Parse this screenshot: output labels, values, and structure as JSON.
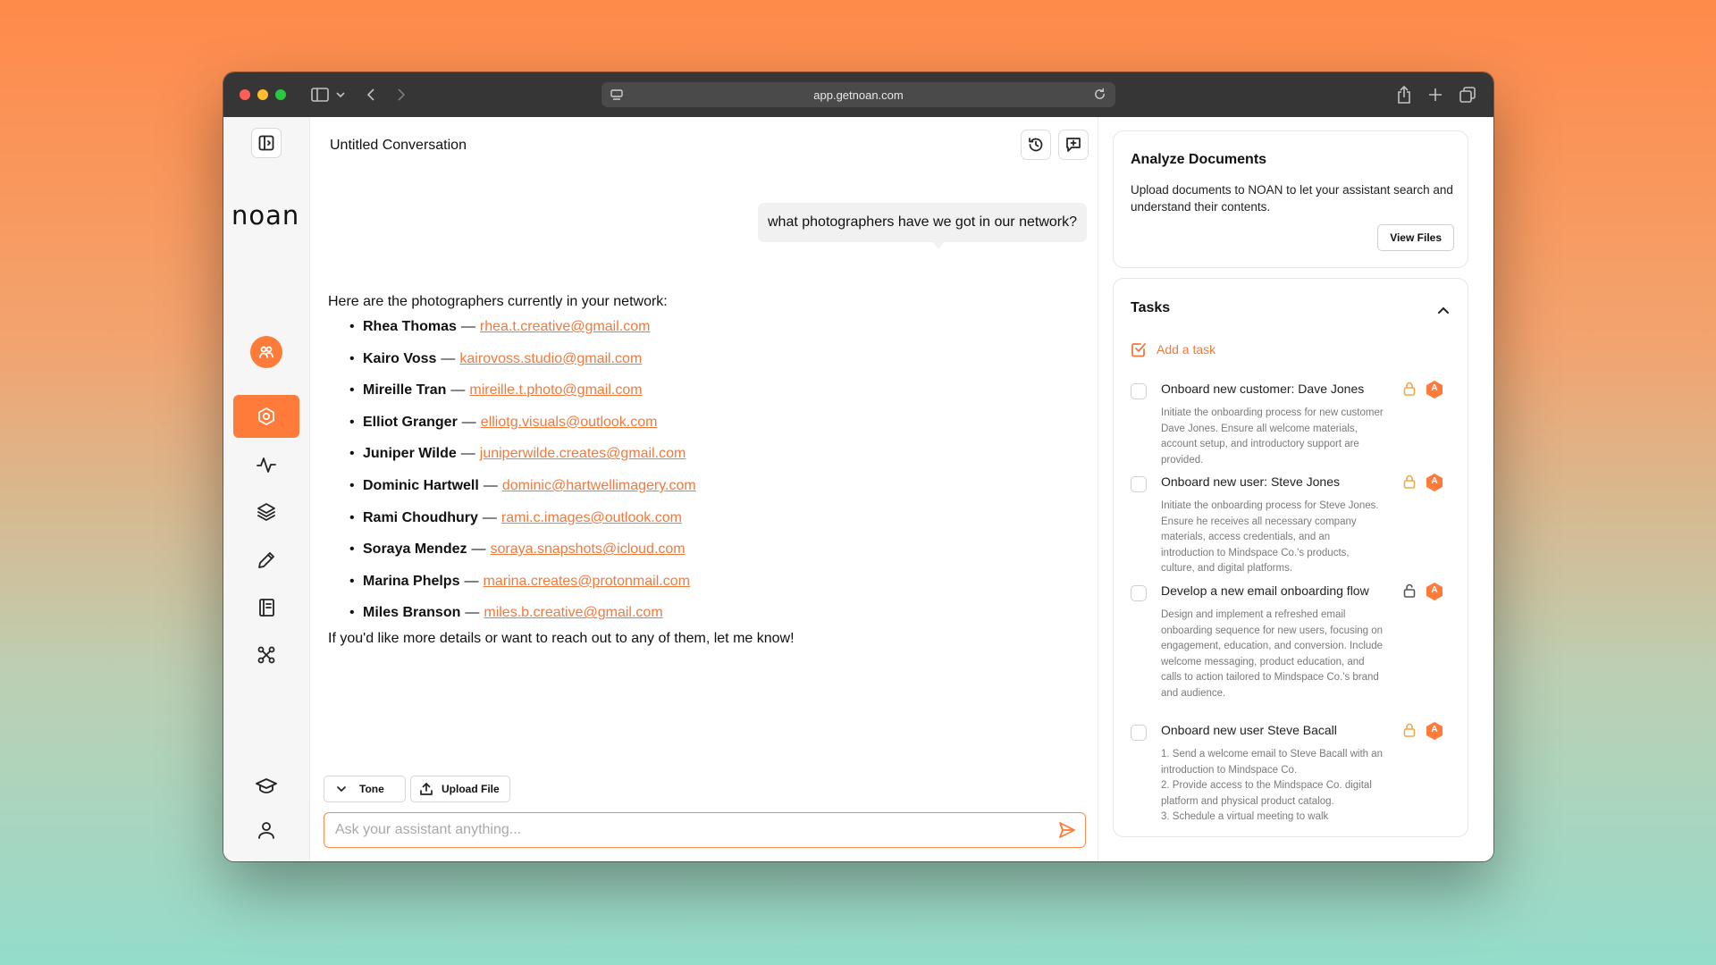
{
  "browser": {
    "url": "app.getnoan.com"
  },
  "rail": {
    "logo": "noan"
  },
  "chat": {
    "title": "Untitled Conversation",
    "user_message": "what photographers have we got in our network?",
    "assistant_intro": "Here are the photographers currently in your network:",
    "photographers": [
      {
        "name": "Rhea Thomas",
        "email": "rhea.t.creative@gmail.com"
      },
      {
        "name": "Kairo Voss",
        "email": "kairovoss.studio@gmail.com"
      },
      {
        "name": "Mireille Tran",
        "email": "mireille.t.photo@gmail.com"
      },
      {
        "name": "Elliot Granger",
        "email": "elliotg.visuals@outlook.com"
      },
      {
        "name": "Juniper Wilde",
        "email": "juniperwilde.creates@gmail.com"
      },
      {
        "name": "Dominic Hartwell",
        "email": "dominic@hartwellimagery.com"
      },
      {
        "name": "Rami Choudhury",
        "email": "rami.c.images@outlook.com"
      },
      {
        "name": "Soraya Mendez",
        "email": "soraya.snapshots@icloud.com"
      },
      {
        "name": "Marina Phelps",
        "email": "marina.creates@protonmail.com"
      },
      {
        "name": "Miles Branson",
        "email": "miles.b.creative@gmail.com"
      }
    ],
    "separator": "—",
    "assistant_outro": "If you'd like more details or want to reach out to any of them, let me know!",
    "tone_label": "Tone",
    "upload_label": "Upload File",
    "composer_placeholder": "Ask your assistant anything..."
  },
  "analyze": {
    "title": "Analyze Documents",
    "description": "Upload documents to NOAN to let your assistant search and understand their contents.",
    "button": "View Files"
  },
  "tasks": {
    "title": "Tasks",
    "add_label": "Add a task",
    "badge_letter": "A",
    "items": [
      {
        "title": "Onboard new customer: Dave Jones",
        "description": "Initiate the onboarding process for new customer Dave Jones. Ensure all welcome materials, account setup, and introductory support are provided.",
        "locked": true
      },
      {
        "title": "Onboard new user: Steve Jones",
        "description": "Initiate the onboarding process for Steve Jones. Ensure he receives all necessary company materials, access credentials, and an introduction to Mindspace Co.'s products, culture, and digital platforms.",
        "locked": true
      },
      {
        "title": "Develop a new email onboarding flow",
        "description": "Design and implement a refreshed email onboarding sequence for new users, focusing on engagement, education, and conversion. Include welcome messaging, product education, and calls to action tailored to Mindspace Co.'s brand and audience.",
        "locked": false
      },
      {
        "title": "Onboard new user Steve Bacall",
        "description_lines": [
          "1. Send a welcome email to Steve Bacall with an introduction to Mindspace Co.",
          "2. Provide access to the Mindspace Co. digital platform and physical product catalog.",
          "3. Schedule a virtual meeting to walk"
        ],
        "locked": true
      }
    ]
  },
  "colors": {
    "accent": "#ff7b3a",
    "link": "#f07a3e",
    "lock_amber": "#f2a84b"
  }
}
